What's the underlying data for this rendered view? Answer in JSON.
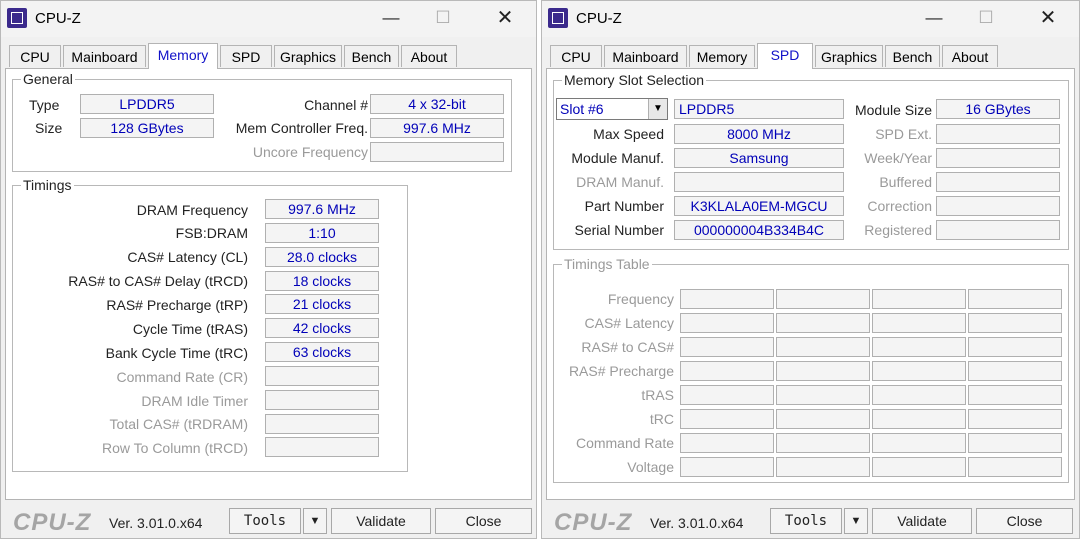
{
  "windows": [
    {
      "title": "CPU-Z",
      "tabs": [
        "CPU",
        "Mainboard",
        "Memory",
        "SPD",
        "Graphics",
        "Bench",
        "About"
      ],
      "active_tab": "Memory",
      "memory": {
        "general_legend": "General",
        "type_label": "Type",
        "type_value": "LPDDR5",
        "size_label": "Size",
        "size_value": "128 GBytes",
        "channel_label": "Channel #",
        "channel_value": "4 x 32-bit",
        "mem_ctrl_label": "Mem Controller Freq.",
        "mem_ctrl_value": "997.6 MHz",
        "uncore_label": "Uncore Frequency",
        "uncore_value": "",
        "timings_legend": "Timings",
        "timings": [
          {
            "label": "DRAM Frequency",
            "value": "997.6 MHz",
            "disabled": false
          },
          {
            "label": "FSB:DRAM",
            "value": "1:10",
            "disabled": false
          },
          {
            "label": "CAS# Latency (CL)",
            "value": "28.0 clocks",
            "disabled": false
          },
          {
            "label": "RAS# to CAS# Delay (tRCD)",
            "value": "18 clocks",
            "disabled": false
          },
          {
            "label": "RAS# Precharge (tRP)",
            "value": "21 clocks",
            "disabled": false
          },
          {
            "label": "Cycle Time (tRAS)",
            "value": "42 clocks",
            "disabled": false
          },
          {
            "label": "Bank Cycle Time (tRC)",
            "value": "63 clocks",
            "disabled": false
          },
          {
            "label": "Command Rate (CR)",
            "value": "",
            "disabled": true
          },
          {
            "label": "DRAM Idle Timer",
            "value": "",
            "disabled": true
          },
          {
            "label": "Total CAS# (tRDRAM)",
            "value": "",
            "disabled": true
          },
          {
            "label": "Row To Column (tRCD)",
            "value": "",
            "disabled": true
          }
        ]
      },
      "footer": {
        "logo": "CPU-Z",
        "version": "Ver. 3.01.0.x64",
        "tools": "Tools",
        "validate": "Validate",
        "close": "Close"
      }
    },
    {
      "title": "CPU-Z",
      "tabs": [
        "CPU",
        "Mainboard",
        "Memory",
        "SPD",
        "Graphics",
        "Bench",
        "About"
      ],
      "active_tab": "SPD",
      "spd": {
        "slot_legend": "Memory Slot Selection",
        "slot_selected": "Slot #6",
        "module_type": "LPDDR5",
        "module_size_label": "Module Size",
        "module_size_value": "16 GBytes",
        "max_speed_label": "Max Speed",
        "max_speed_value": "8000 MHz",
        "spd_ext_label": "SPD Ext.",
        "spd_ext_value": "",
        "module_manuf_label": "Module Manuf.",
        "module_manuf_value": "Samsung",
        "week_year_label": "Week/Year",
        "week_year_value": "",
        "dram_manuf_label": "DRAM Manuf.",
        "dram_manuf_value": "",
        "buffered_label": "Buffered",
        "buffered_value": "",
        "part_number_label": "Part Number",
        "part_number_value": "K3KLALA0EM-MGCU",
        "correction_label": "Correction",
        "correction_value": "",
        "serial_number_label": "Serial Number",
        "serial_number_value": "000000004B334B4C",
        "registered_label": "Registered",
        "registered_value": "",
        "timings_table_legend": "Timings Table",
        "timings_table_rows": [
          "Frequency",
          "CAS# Latency",
          "RAS# to CAS#",
          "RAS# Precharge",
          "tRAS",
          "tRC",
          "Command Rate",
          "Voltage"
        ]
      },
      "footer": {
        "logo": "CPU-Z",
        "version": "Ver. 3.01.0.x64",
        "tools": "Tools",
        "validate": "Validate",
        "close": "Close"
      }
    }
  ]
}
